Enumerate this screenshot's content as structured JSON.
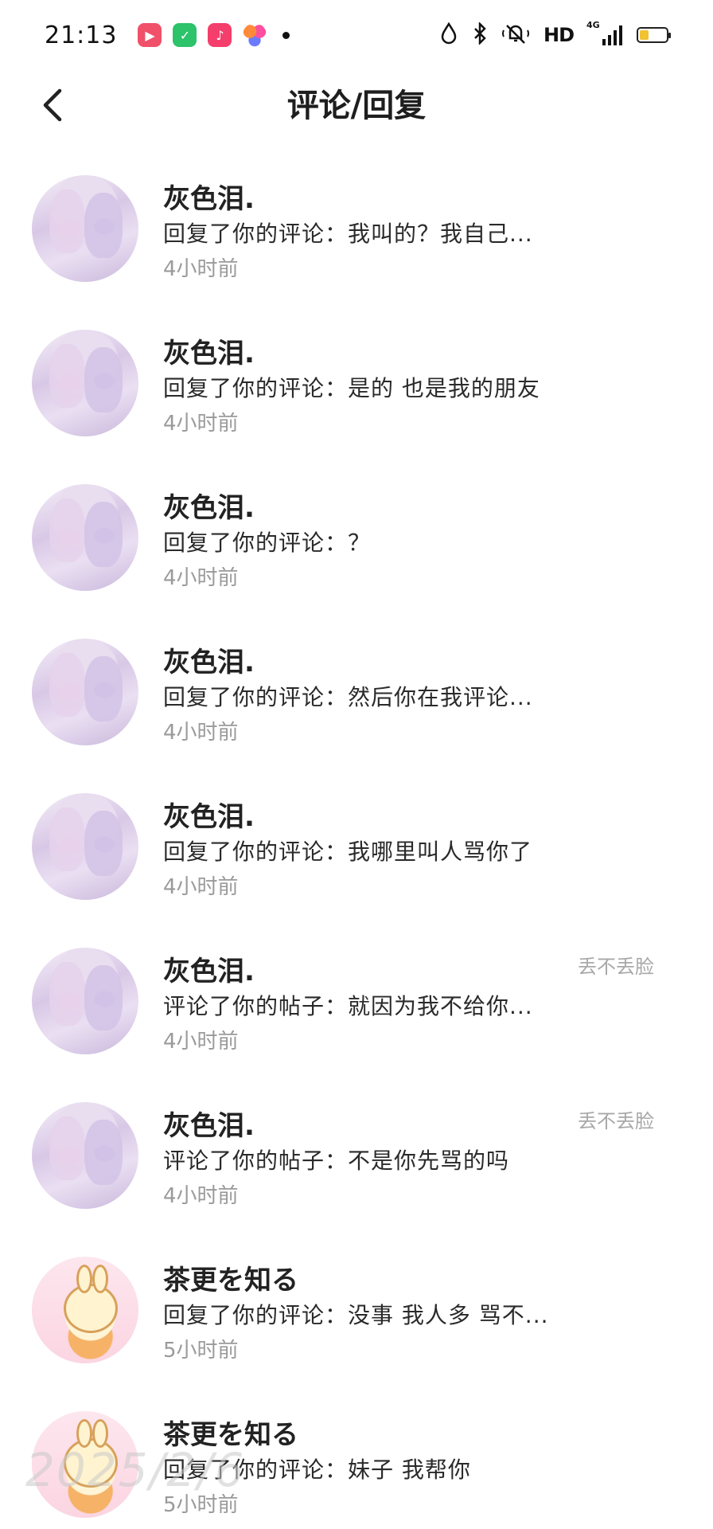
{
  "status_bar": {
    "time": "21:13",
    "hd_label": "HD",
    "network_label": "4G",
    "battery_level": 0.35
  },
  "header": {
    "title": "评论/回复"
  },
  "notifications": [
    {
      "user": "灰色泪.",
      "text": "回复了你的评论：我叫的？我自己...",
      "time": "4小时前",
      "post": "",
      "avatar": "anime"
    },
    {
      "user": "灰色泪.",
      "text": "回复了你的评论：是的 也是我的朋友",
      "time": "4小时前",
      "post": "",
      "avatar": "anime"
    },
    {
      "user": "灰色泪.",
      "text": "回复了你的评论：？",
      "time": "4小时前",
      "post": "",
      "avatar": "anime"
    },
    {
      "user": "灰色泪.",
      "text": "回复了你的评论：然后你在我评论...",
      "time": "4小时前",
      "post": "",
      "avatar": "anime"
    },
    {
      "user": "灰色泪.",
      "text": "回复了你的评论：我哪里叫人骂你了",
      "time": "4小时前",
      "post": "",
      "avatar": "anime"
    },
    {
      "user": "灰色泪.",
      "text": "评论了你的帖子：就因为我不给你...",
      "time": "4小时前",
      "post": "丢不丢脸",
      "avatar": "anime"
    },
    {
      "user": "灰色泪.",
      "text": "评论了你的帖子：不是你先骂的吗",
      "time": "4小时前",
      "post": "丢不丢脸",
      "avatar": "anime"
    },
    {
      "user": "茶更を知る",
      "text": "回复了你的评论：没事 我人多 骂不...",
      "time": "5小时前",
      "post": "",
      "avatar": "cute"
    },
    {
      "user": "茶更を知る",
      "text": "回复了你的评论：妹子 我帮你",
      "time": "5小时前",
      "post": "",
      "avatar": "cute"
    }
  ],
  "watermark": "2025/2/6"
}
